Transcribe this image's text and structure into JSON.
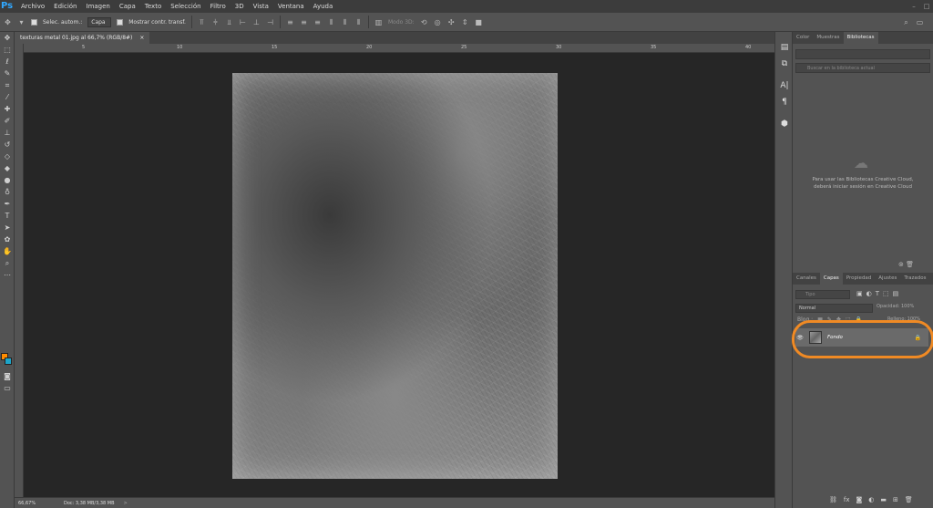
{
  "app": {
    "logo": "Ps"
  },
  "menu": [
    "Archivo",
    "Edición",
    "Imagen",
    "Capa",
    "Texto",
    "Selección",
    "Filtro",
    "3D",
    "Vista",
    "Ventana",
    "Ayuda"
  ],
  "options": {
    "auto_select_label": "Selec. autom.:",
    "auto_select_value": "Capa",
    "show_transform_label": "Mostrar contr. transf.",
    "mode3d_label": "Modo 3D:"
  },
  "document": {
    "tab_title": "texturas metal 01.jpg al 66,7% (RGB/8#)",
    "tab_close": "×"
  },
  "rulers": [
    "5",
    "10",
    "15",
    "20",
    "25",
    "30",
    "35",
    "40"
  ],
  "status": {
    "zoom": "66,67%",
    "doc_info": "Doc: 3,38 MB/3,38 MB",
    "arrow": ">"
  },
  "panels": {
    "top_tabs": [
      "Color",
      "Muestras",
      "Bibliotecas"
    ],
    "library_search_placeholder": "Buscar en la biblioteca actual",
    "library_message_line1": "Para usar las Bibliotecas Creative Cloud,",
    "library_message_line2": "deberá iniciar sesión en Creative Cloud",
    "layer_tabs": [
      "Canales",
      "Capas",
      "Propiedad",
      "Ajustes",
      "Trazados"
    ],
    "layer_filter_placeholder": "Tipo",
    "blend_mode": "Normal",
    "opacity_label": "Opacidad: 100%",
    "lock_label": "Bloq.:",
    "fill_label": "Relleno: 100%",
    "layer_name": "Fondo"
  },
  "colors": {
    "accent": "#31a8ff",
    "foreground_color": "#ff8c00",
    "background_color": "#1da5c9",
    "highlight_ring": "#f08a24"
  }
}
